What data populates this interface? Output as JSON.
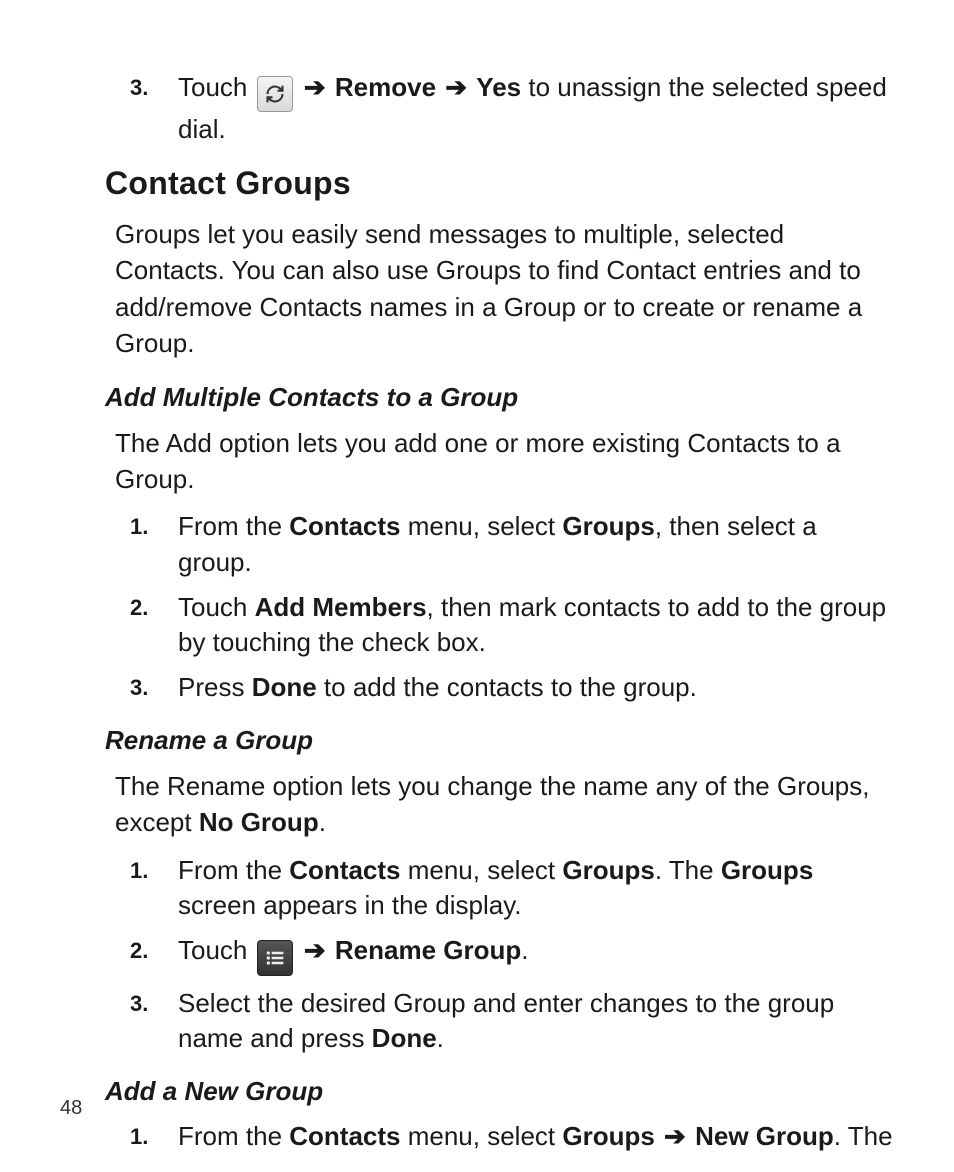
{
  "page_number": "48",
  "top_step": {
    "num": "3.",
    "pre": "Touch ",
    "icon_name": "refresh-icon",
    "arrow1": "➔",
    "remove": "Remove",
    "arrow2": "➔",
    "yes": "Yes",
    "post": " to unassign the selected speed dial."
  },
  "section": {
    "heading": "Contact Groups",
    "intro": "Groups let you easily send messages to multiple, selected Contacts. You can also use Groups to find Contact entries and to add/remove Contacts names in a Group or to create or rename a Group."
  },
  "sub_add_multiple": {
    "heading": "Add Multiple Contacts to a Group",
    "intro": "The Add option lets you add one or more existing Contacts to a Group.",
    "steps": [
      {
        "num": "1.",
        "parts": [
          "From the ",
          "Contacts",
          " menu, select ",
          "Groups",
          ", then select a group."
        ]
      },
      {
        "num": "2.",
        "parts": [
          "Touch ",
          "Add Members",
          ", then mark contacts to add to the group by touching the check box."
        ]
      },
      {
        "num": "3.",
        "parts": [
          "Press ",
          "Done",
          " to add the contacts to the group."
        ]
      }
    ]
  },
  "sub_rename": {
    "heading": "Rename a Group",
    "intro_pre": "The Rename option lets you change the name any of the Groups, except ",
    "intro_bold": "No Group",
    "intro_post": ".",
    "step1": {
      "num": "1.",
      "parts": [
        "From the ",
        "Contacts",
        " menu, select ",
        "Groups",
        ". The ",
        "Groups",
        " screen appears in the display."
      ]
    },
    "step2": {
      "num": "2.",
      "pre": "Touch ",
      "icon_name": "menu-list-icon",
      "arrow": "➔",
      "bold": "Rename Group",
      "post": "."
    },
    "step3": {
      "num": "3.",
      "parts": [
        "Select the desired Group and enter changes to the group name and press ",
        "Done",
        "."
      ]
    }
  },
  "sub_add_new": {
    "heading": "Add a New Group",
    "step1": {
      "num": "1.",
      "pre": "From the ",
      "b1": "Contacts",
      "mid": " menu, select ",
      "b2": "Groups",
      "arrow": "➔",
      "b3": "New Group",
      "post": ". The"
    }
  }
}
